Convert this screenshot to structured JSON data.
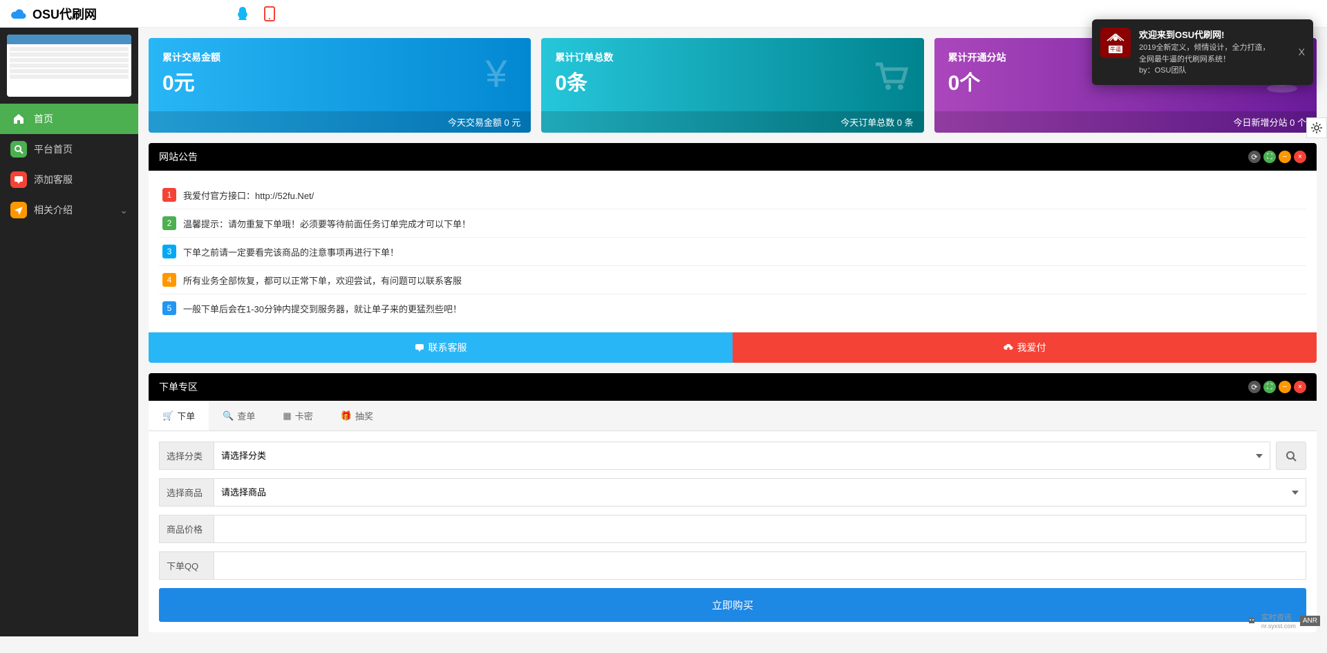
{
  "app": {
    "title": "OSU代刷网"
  },
  "header_icons": [
    "qq",
    "phone"
  ],
  "sidebar": {
    "items": [
      {
        "label": "首页",
        "icon": "home",
        "color": "active"
      },
      {
        "label": "平台首页",
        "icon": "search",
        "color": "green"
      },
      {
        "label": "添加客服",
        "icon": "chat",
        "color": "red"
      },
      {
        "label": "相关介绍",
        "icon": "paper-plane",
        "color": "orange",
        "expandable": true
      }
    ]
  },
  "stats": [
    {
      "label": "累计交易金额",
      "value": "0元",
      "footer": "今天交易金额 0 元",
      "color": "blue",
      "icon": "yen"
    },
    {
      "label": "累计订单总数",
      "value": "0条",
      "footer": "今天订单总数 0 条",
      "color": "teal",
      "icon": "cart"
    },
    {
      "label": "累计开通分站",
      "value": "0个",
      "footer": "今日新增分站 0 个",
      "color": "purple",
      "icon": "globe"
    }
  ],
  "notice_panel": {
    "title": "网站公告",
    "items": [
      "我爱付官方接口：http://52fu.Net/",
      "温馨提示：请勿重复下单哦！必须要等待前面任务订单完成才可以下单！",
      "下单之前请一定要看完该商品的注意事项再进行下单！",
      "所有业务全部恢复，都可以正常下单，欢迎尝试，有问题可以联系客服",
      "一般下单后会在1-30分钟内提交到服务器，就让单子来的更猛烈些吧！"
    ],
    "buttons": {
      "contact": "联系客服",
      "pay": "我爱付"
    }
  },
  "order_panel": {
    "title": "下单专区",
    "tabs": [
      {
        "label": "下单",
        "icon": "cart"
      },
      {
        "label": "查单",
        "icon": "search"
      },
      {
        "label": "卡密",
        "icon": "grid"
      },
      {
        "label": "抽奖",
        "icon": "gift"
      }
    ],
    "form": {
      "category_label": "选择分类",
      "category_placeholder": "请选择分类",
      "product_label": "选择商品",
      "product_placeholder": "请选择商品",
      "price_label": "商品价格",
      "qq_label": "下单QQ",
      "buy_button": "立即购买"
    }
  },
  "toast": {
    "title": "欢迎来到OSU代刷网!",
    "line1": "2019全新定义，倾情设计，全力打造，",
    "line2": "全网最牛逼的代刷网系统！",
    "line3": "by：OSU团队",
    "logo_text": "牛逼"
  },
  "watermark": {
    "text1": "实时资讯",
    "text2": "nr.syxst.com",
    "badge": "ANR"
  }
}
